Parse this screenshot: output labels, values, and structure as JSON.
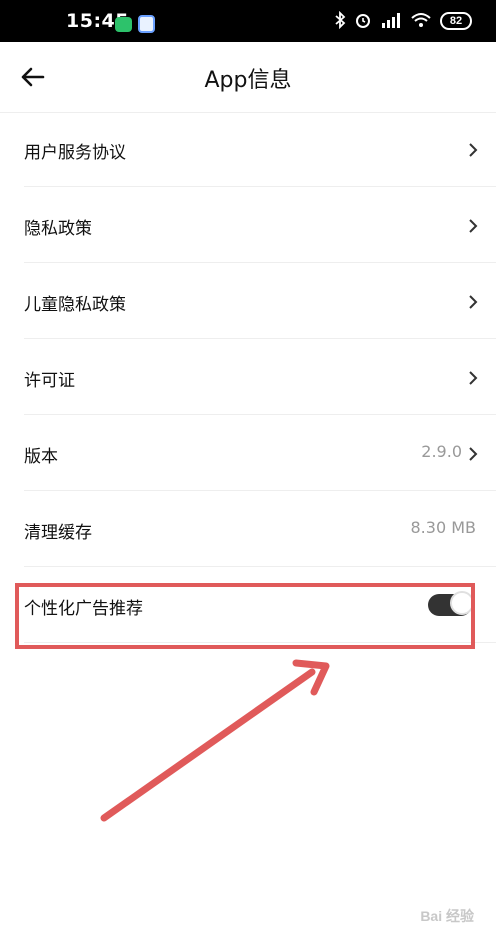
{
  "status_bar": {
    "time": "15:45",
    "battery": "82",
    "icons": [
      "wechat-icon",
      "app-icon",
      "bluetooth-icon",
      "alarm-icon",
      "hd-signal-icon",
      "wifi-icon",
      "battery-icon"
    ]
  },
  "header": {
    "title": "App信息",
    "back_icon": "arrow-left-icon"
  },
  "items": [
    {
      "label": "用户服务协议",
      "value": "",
      "chevron": true
    },
    {
      "label": "隐私政策",
      "value": "",
      "chevron": true
    },
    {
      "label": "儿童隐私政策",
      "value": "",
      "chevron": true
    },
    {
      "label": "许可证",
      "value": "",
      "chevron": true
    },
    {
      "label": "版本",
      "value": "2.9.0",
      "chevron": true
    },
    {
      "label": "清理缓存",
      "value": "8.30 MB",
      "chevron": false
    },
    {
      "label": "个性化广告推荐",
      "toggle": "on"
    }
  ],
  "colors": {
    "highlight": "#e05a5a",
    "toggle_on": "#333333"
  },
  "watermark": "Bai 经验"
}
